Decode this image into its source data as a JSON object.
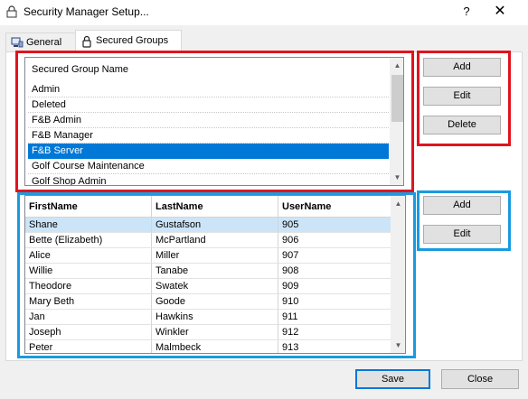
{
  "window": {
    "title": "Security Manager Setup...",
    "help_glyph": "?",
    "close_glyph": "✕"
  },
  "tabs": [
    {
      "label": "General",
      "icon": "network-computer-icon"
    },
    {
      "label": "Secured Groups",
      "icon": "lock-icon",
      "active": true
    }
  ],
  "groups": {
    "header": "Secured Group Name",
    "items": [
      "Admin",
      "Deleted",
      "F&B Admin",
      "F&B Manager",
      "F&B Server",
      "Golf Course Maintenance",
      "Golf Shop Admin"
    ],
    "selected": "F&B Server",
    "buttons": {
      "add": "Add",
      "edit": "Edit",
      "delete": "Delete"
    }
  },
  "users": {
    "columns": [
      "FirstName",
      "LastName",
      "UserName"
    ],
    "rows": [
      [
        "Shane",
        "Gustafson",
        "905"
      ],
      [
        "Bette (Elizabeth)",
        "McPartland",
        "906"
      ],
      [
        "Alice",
        "Miller",
        "907"
      ],
      [
        "Willie",
        "Tanabe",
        "908"
      ],
      [
        "Theodore",
        "Swatek",
        "909"
      ],
      [
        "Mary Beth",
        "Goode",
        "910"
      ],
      [
        "Jan",
        "Hawkins",
        "911"
      ],
      [
        "Joseph",
        "Winkler",
        "912"
      ],
      [
        "Peter",
        "Malmbeck",
        "913"
      ]
    ],
    "buttons": {
      "add": "Add",
      "edit": "Edit"
    }
  },
  "footer": {
    "save": "Save",
    "close": "Close"
  },
  "colors": {
    "highlight_red": "#e0141e",
    "highlight_blue": "#1a9be0",
    "selection": "#0078d7"
  }
}
